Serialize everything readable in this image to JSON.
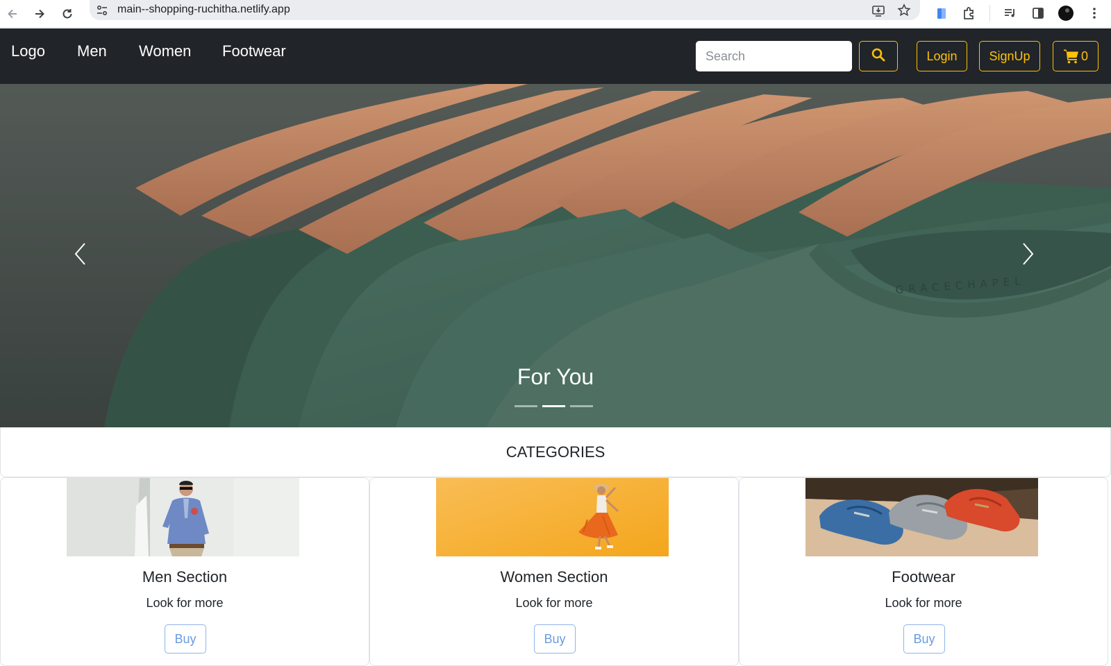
{
  "browser": {
    "url": "main--shopping-ruchitha.netlify.app"
  },
  "navbar": {
    "logo": "Logo",
    "links": [
      "Men",
      "Women",
      "Footwear"
    ],
    "search_placeholder": "Search",
    "login_label": "Login",
    "signup_label": "SignUp",
    "cart_count": "0",
    "accent_color": "#ffc107",
    "bg_color": "#212529"
  },
  "carousel": {
    "caption": "For You",
    "slide_count": 3,
    "active_slide": 2,
    "shirt_print_text": "GRACECHAPEL"
  },
  "categories": {
    "title": "CATEGORIES",
    "cards": [
      {
        "title": "Men Section",
        "text": "Look for more",
        "button": "Buy"
      },
      {
        "title": "Women Section",
        "text": "Look for more",
        "button": "Buy"
      },
      {
        "title": "Footwear",
        "text": "Look for more",
        "button": "Buy"
      }
    ]
  }
}
